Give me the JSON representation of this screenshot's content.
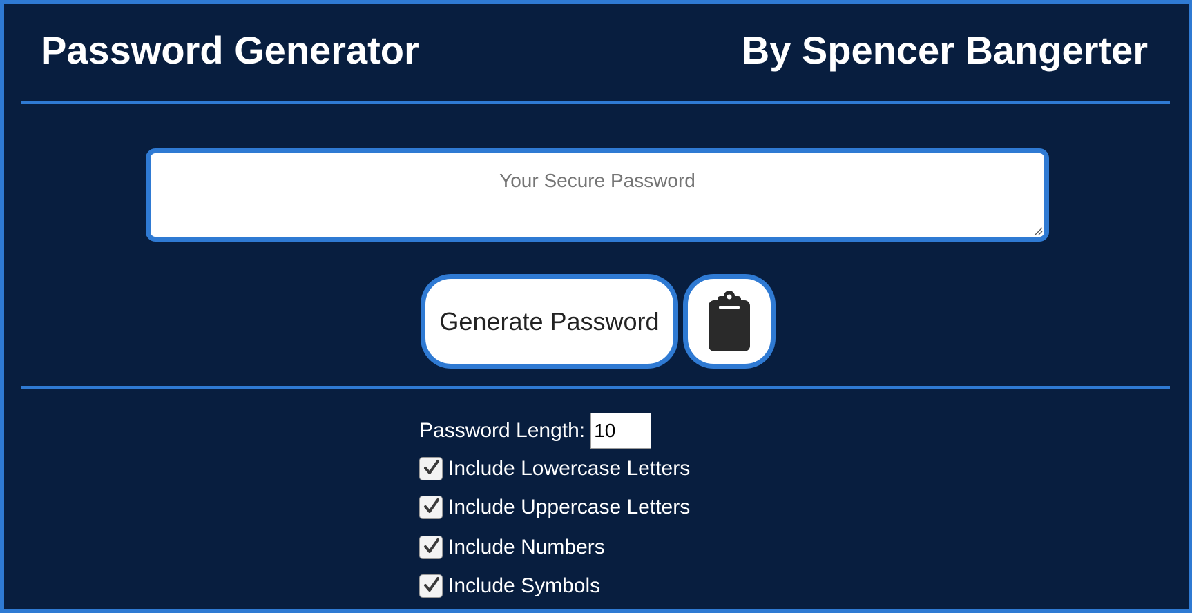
{
  "header": {
    "title": "Password Generator",
    "author": "By Spencer Bangerter"
  },
  "password_output": {
    "value": "",
    "placeholder": "Your Secure Password"
  },
  "actions": {
    "generate_label": "Generate Password",
    "copy_icon": "clipboard-icon"
  },
  "options": {
    "length_label": "Password Length:",
    "length_value": "10",
    "checkboxes": [
      {
        "label": "Include Lowercase Letters",
        "checked": true
      },
      {
        "label": "Include Uppercase Letters",
        "checked": true
      },
      {
        "label": "Include Numbers",
        "checked": true
      },
      {
        "label": "Include Symbols",
        "checked": true
      }
    ]
  },
  "colors": {
    "background": "#081e3f",
    "accent": "#2f7ad3",
    "button_bg": "#ffffff",
    "button_text": "#222222"
  }
}
